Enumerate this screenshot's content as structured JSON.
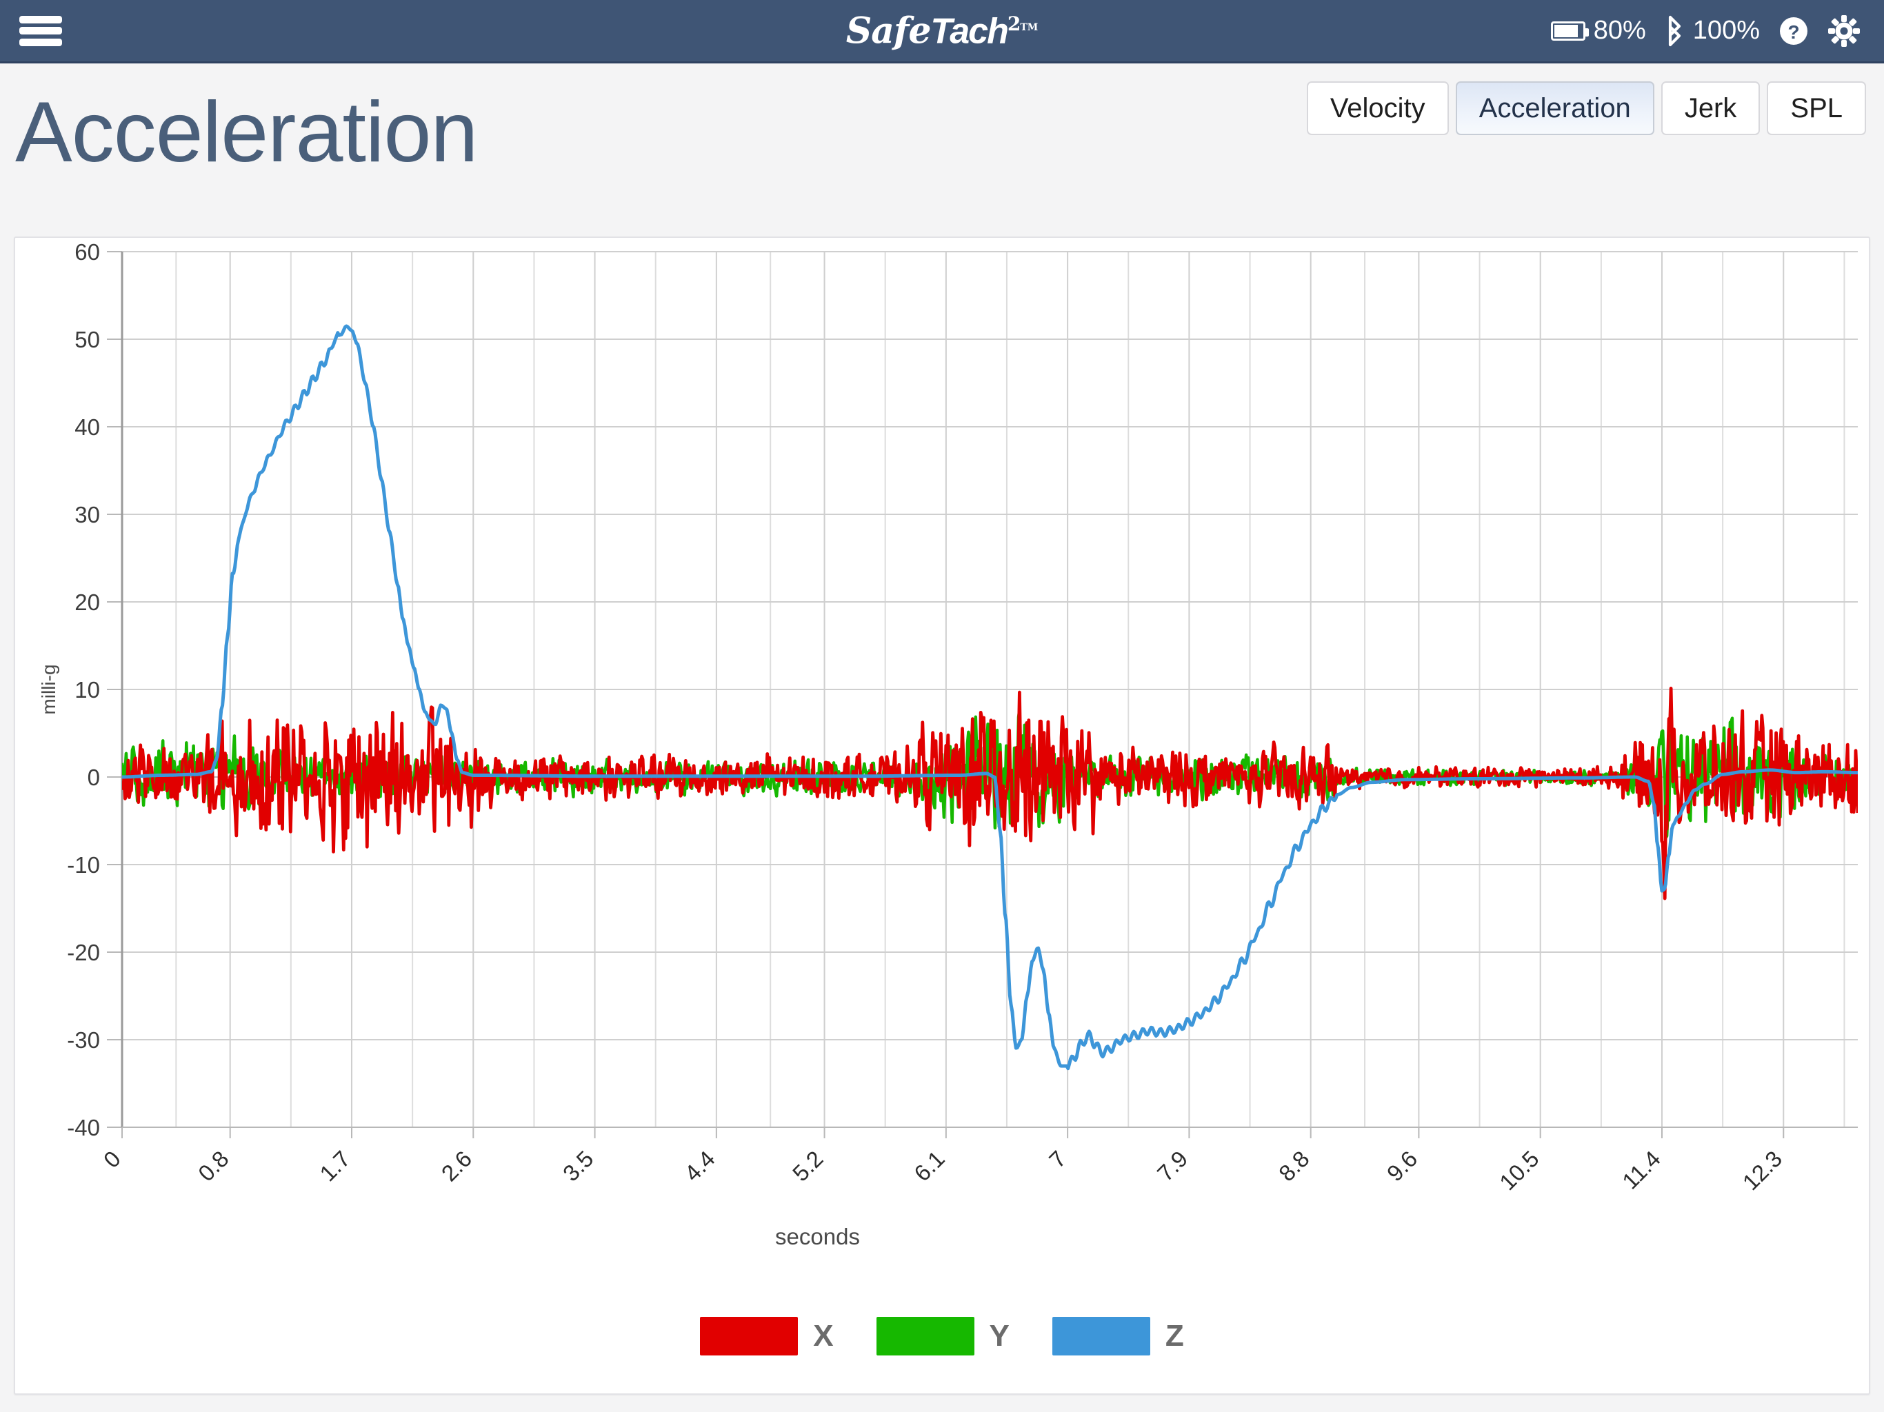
{
  "header": {
    "menu_icon": "hamburger-menu-icon",
    "brand": {
      "part1": "Safe",
      "part2": "Tach",
      "superscript": "2",
      "tm": "TM"
    },
    "battery_icon": "battery-icon",
    "battery_value": "80%",
    "bluetooth_icon": "bluetooth-icon",
    "bluetooth_value": "100%",
    "help_icon": "question-mark-icon",
    "settings_icon": "gear-icon"
  },
  "tabs": [
    {
      "label": "Velocity",
      "active": false
    },
    {
      "label": "Acceleration",
      "active": true
    },
    {
      "label": "Jerk",
      "active": false
    },
    {
      "label": "SPL",
      "active": false
    }
  ],
  "page": {
    "title": "Acceleration"
  },
  "legend": [
    {
      "label": "X",
      "color": "#e10000"
    },
    {
      "label": "Y",
      "color": "#16b800"
    },
    {
      "label": "Z",
      "color": "#3d96d9"
    }
  ],
  "chart_data": {
    "type": "line",
    "title": "Acceleration",
    "xlabel": "seconds",
    "ylabel": "milli-g",
    "xlim": [
      0,
      12.85
    ],
    "ylim": [
      -40,
      60
    ],
    "grid": true,
    "legend_position": "bottom",
    "ytick_labels": [
      "60",
      "50",
      "40",
      "30",
      "20",
      "10",
      "0",
      "-10",
      "-20",
      "-30",
      "-40"
    ],
    "ytick_values": [
      60,
      50,
      40,
      30,
      20,
      10,
      0,
      -10,
      -20,
      -30,
      -40
    ],
    "xtick_labels": [
      "0",
      "0.8",
      "1.7",
      "2.6",
      "3.5",
      "4.4",
      "5.2",
      "6.1",
      "7",
      "7.9",
      "8.8",
      "9.6",
      "10.5",
      "11.4",
      "12.3"
    ],
    "xtick_values": [
      0,
      0.8,
      1.7,
      2.6,
      3.5,
      4.4,
      5.2,
      6.1,
      7,
      7.9,
      8.8,
      9.6,
      10.5,
      11.4,
      12.3
    ],
    "series": [
      {
        "name": "X",
        "color": "#e10000",
        "description": "High-frequency noise centered on 0 milli-g, amplitude mostly +/-4, bursts to +/-9 between 0.8-2.6 s and 6.1-7 s, sharp spike to -11 at 11.4 s, decaying noise to end.",
        "noise": {
          "base_amplitude": 3.2,
          "bursts": [
            [
              0.6,
              2.7,
              8.5
            ],
            [
              5.9,
              7.2,
              9.0
            ],
            [
              11.2,
              12.85,
              6.5
            ]
          ]
        },
        "spikes": [
          [
            11.42,
            -11.0
          ],
          [
            11.46,
            7.5
          ],
          [
            6.45,
            7.2
          ]
        ]
      },
      {
        "name": "Y",
        "color": "#16b800",
        "description": "High-frequency noise centered on 0 milli-g, amplitude mostly +/-3, bursts to +/-7 between 6.1-7 s, sharp spike to +7 at 11.4 s.",
        "noise": {
          "base_amplitude": 2.4,
          "bursts": [
            [
              0.0,
              1.2,
              4.5
            ],
            [
              6.0,
              7.0,
              7.2
            ],
            [
              11.3,
              12.4,
              6.0
            ]
          ]
        },
        "spikes": [
          [
            11.4,
            7.0
          ],
          [
            11.43,
            -8.0
          ]
        ]
      },
      {
        "name": "Z",
        "color": "#3d96d9",
        "description": "Smooth trace: flat near 0, rapid rise from 0.70 s to peak 51.5 milli-g at 1.66 s, fall to ~8 at 2.25 s, small shoulder, back to 0 by 2.45 s; flat until 6.45 s; plunge to -31 at 6.62 s, rebound to -19.5 at 6.78 s, second trough -33 at 6.95 s, slow recovery reaching 0 near 8.9 s; flat until negative spike to -13 at 11.40 s, then flat to end.",
        "points": [
          [
            0.0,
            0.0
          ],
          [
            0.3,
            0.2
          ],
          [
            0.55,
            0.3
          ],
          [
            0.66,
            0.6
          ],
          [
            0.7,
            2.0
          ],
          [
            0.74,
            8.0
          ],
          [
            0.78,
            16.0
          ],
          [
            0.82,
            23.0
          ],
          [
            0.86,
            27.0
          ],
          [
            0.92,
            30.5
          ],
          [
            0.98,
            33.0
          ],
          [
            1.05,
            35.5
          ],
          [
            1.12,
            37.5
          ],
          [
            1.18,
            39.5
          ],
          [
            1.24,
            41.0
          ],
          [
            1.3,
            42.5
          ],
          [
            1.36,
            44.0
          ],
          [
            1.42,
            45.5
          ],
          [
            1.48,
            47.0
          ],
          [
            1.54,
            48.5
          ],
          [
            1.58,
            50.3
          ],
          [
            1.62,
            50.5
          ],
          [
            1.66,
            51.5
          ],
          [
            1.7,
            51.0
          ],
          [
            1.74,
            49.5
          ],
          [
            1.8,
            45.0
          ],
          [
            1.86,
            40.0
          ],
          [
            1.92,
            34.0
          ],
          [
            1.98,
            28.0
          ],
          [
            2.04,
            22.0
          ],
          [
            2.08,
            18.0
          ],
          [
            2.12,
            15.0
          ],
          [
            2.16,
            12.5
          ],
          [
            2.2,
            10.0
          ],
          [
            2.24,
            7.5
          ],
          [
            2.28,
            6.5
          ],
          [
            2.32,
            6.0
          ],
          [
            2.36,
            8.2
          ],
          [
            2.4,
            7.8
          ],
          [
            2.44,
            5.0
          ],
          [
            2.48,
            2.0
          ],
          [
            2.52,
            0.5
          ],
          [
            2.6,
            0.2
          ],
          [
            3.5,
            0.1
          ],
          [
            4.5,
            0.1
          ],
          [
            5.5,
            0.1
          ],
          [
            6.2,
            0.2
          ],
          [
            6.4,
            0.4
          ],
          [
            6.46,
            0.0
          ],
          [
            6.5,
            -6.0
          ],
          [
            6.54,
            -16.0
          ],
          [
            6.58,
            -26.0
          ],
          [
            6.62,
            -31.0
          ],
          [
            6.66,
            -30.0
          ],
          [
            6.7,
            -25.0
          ],
          [
            6.74,
            -21.0
          ],
          [
            6.78,
            -19.5
          ],
          [
            6.82,
            -22.0
          ],
          [
            6.86,
            -27.0
          ],
          [
            6.9,
            -31.0
          ],
          [
            6.95,
            -33.0
          ],
          [
            7.0,
            -33.0
          ],
          [
            7.05,
            -32.0
          ],
          [
            7.1,
            -30.5
          ],
          [
            7.16,
            -29.5
          ],
          [
            7.2,
            -30.5
          ],
          [
            7.26,
            -31.5
          ],
          [
            7.32,
            -31.0
          ],
          [
            7.4,
            -30.0
          ],
          [
            7.5,
            -29.5
          ],
          [
            7.6,
            -29.0
          ],
          [
            7.7,
            -29.2
          ],
          [
            7.8,
            -28.8
          ],
          [
            7.9,
            -28.0
          ],
          [
            8.0,
            -27.0
          ],
          [
            8.1,
            -25.5
          ],
          [
            8.2,
            -23.5
          ],
          [
            8.3,
            -21.0
          ],
          [
            8.4,
            -18.0
          ],
          [
            8.5,
            -14.5
          ],
          [
            8.6,
            -11.0
          ],
          [
            8.7,
            -8.0
          ],
          [
            8.8,
            -5.5
          ],
          [
            8.9,
            -3.5
          ],
          [
            9.0,
            -2.0
          ],
          [
            9.1,
            -1.2
          ],
          [
            9.25,
            -0.6
          ],
          [
            9.5,
            -0.3
          ],
          [
            10.0,
            -0.2
          ],
          [
            10.8,
            -0.1
          ],
          [
            11.2,
            0.0
          ],
          [
            11.3,
            -0.5
          ],
          [
            11.34,
            -3.0
          ],
          [
            11.37,
            -8.0
          ],
          [
            11.4,
            -13.0
          ],
          [
            11.42,
            -12.8
          ],
          [
            11.45,
            -9.0
          ],
          [
            11.48,
            -5.5
          ],
          [
            11.52,
            -4.5
          ],
          [
            11.58,
            -3.0
          ],
          [
            11.64,
            -1.5
          ],
          [
            11.72,
            -0.8
          ],
          [
            11.85,
            0.3
          ],
          [
            12.0,
            0.6
          ],
          [
            12.2,
            0.8
          ],
          [
            12.4,
            0.5
          ],
          [
            12.6,
            0.6
          ],
          [
            12.85,
            0.5
          ]
        ]
      }
    ]
  }
}
